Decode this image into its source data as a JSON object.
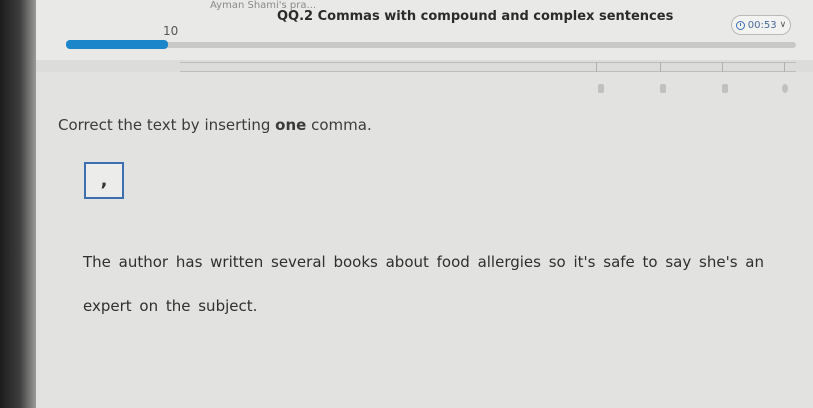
{
  "header": {
    "breadcrumb": "Ayman Shami's pra...",
    "title": "QQ.2 Commas with compound and complex sentences",
    "progress_number": "10",
    "progress_fraction": 0.14
  },
  "timer": {
    "value": "00:53",
    "icon": "clock-icon",
    "chevron": "chevron-down-icon"
  },
  "question": {
    "instruction_prefix": "Correct the text by inserting ",
    "instruction_bold": "one",
    "instruction_suffix": " comma.",
    "tile_symbol": ",",
    "sentence": "The author has written several books about food allergies so it's safe to say she's an expert on the subject."
  },
  "colors": {
    "accent": "#1b86c9",
    "tile_border": "#3d6fb0"
  }
}
